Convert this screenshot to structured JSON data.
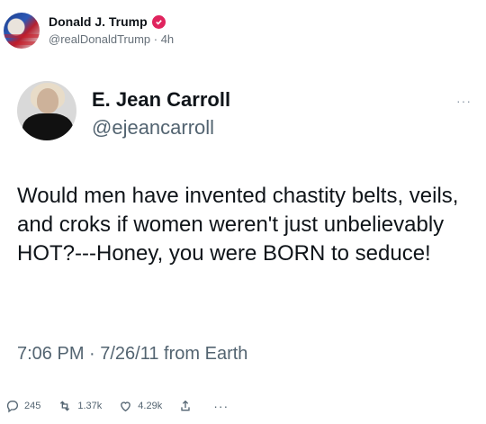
{
  "outer_post": {
    "author_name": "Donald J. Trump",
    "handle_time": "@realDonaldTrump · 4h",
    "verified_color": "#e0245e"
  },
  "quoted_tweet": {
    "author_name": "E. Jean Carroll",
    "handle": "@ejeancarroll",
    "more_label": "···",
    "text": "Would men have invented chastity belts, veils, and croks if women weren't just unbelievably HOT?---Honey, you were BORN to seduce!",
    "meta": "7:06 PM · 7/26/11 from Earth"
  },
  "actions": {
    "replies": "245",
    "reposts": "1.37k",
    "likes": "4.29k",
    "more": "···"
  },
  "icons": [
    "avatar-image",
    "verified-badge-icon",
    "reply-icon",
    "repost-icon",
    "like-icon",
    "share-icon",
    "more-icon"
  ]
}
